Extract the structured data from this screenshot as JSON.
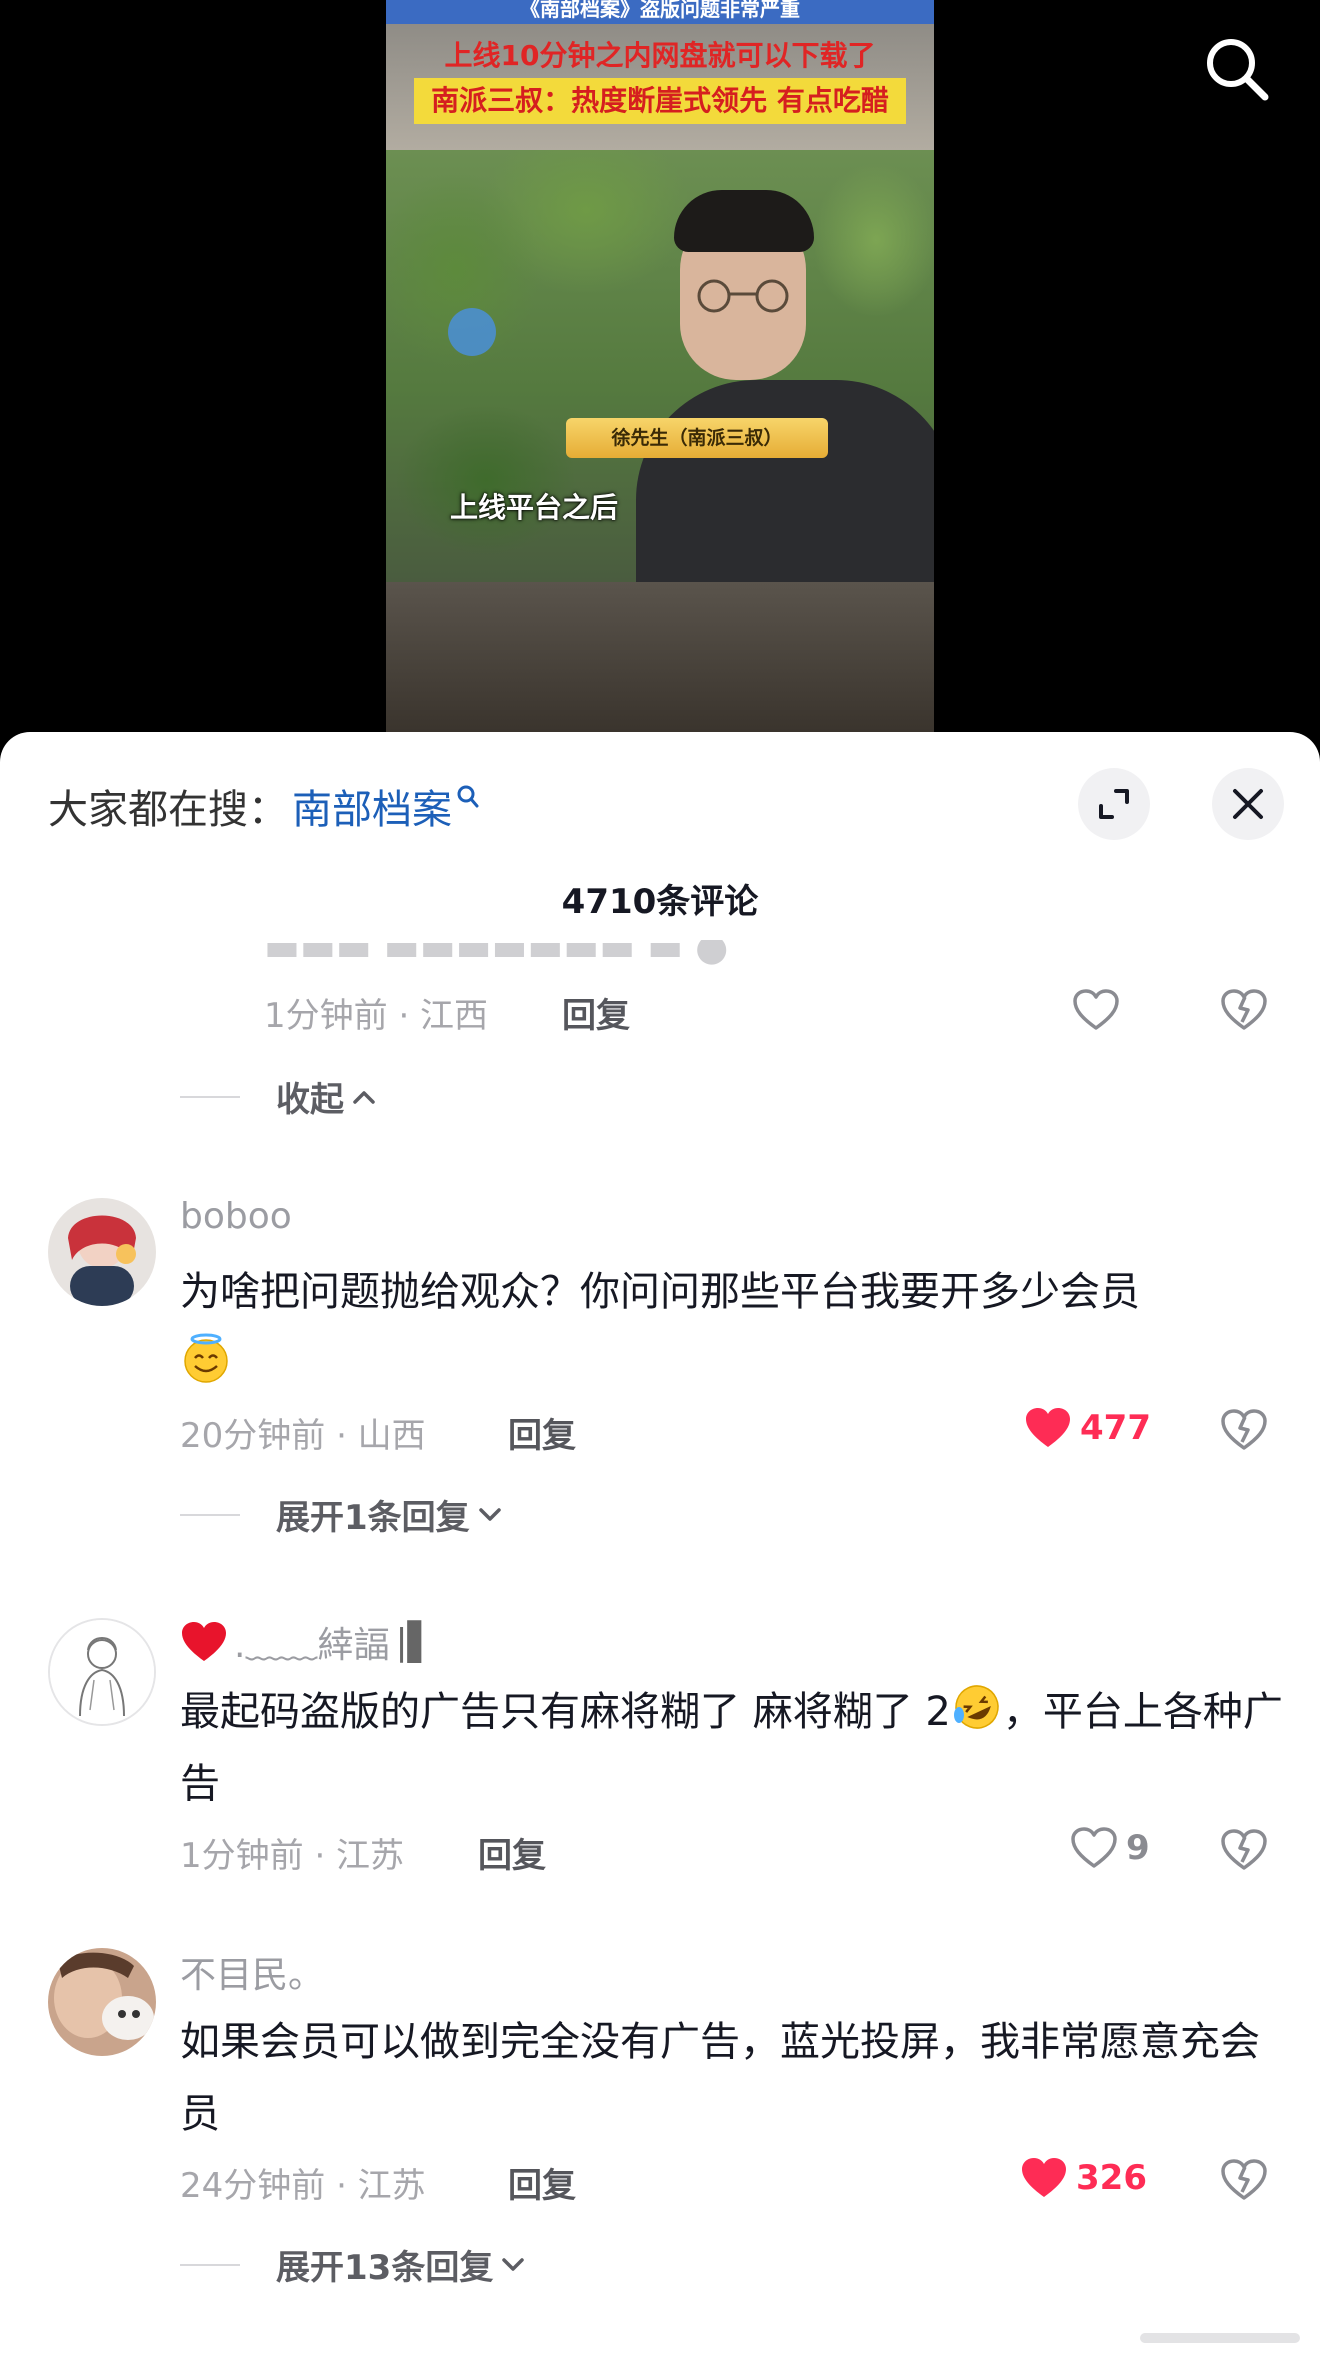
{
  "video": {
    "top_strip": "《南部档案》盗版问题非常严重",
    "headline_1": "上线10分钟之内网盘就可以下载了",
    "headline_2": "南派三叔：热度断崖式领先 有点吃醋",
    "name_tag": "徐先生（南派三叔）",
    "caption": "上线平台之后",
    "search_icon": "search-icon"
  },
  "sheet": {
    "search_prefix": "大家都在搜：",
    "search_term": "南部档案",
    "comment_count": "4710条评论",
    "colors": {
      "accent_link": "#1c5fb8",
      "like_red": "#fe2c55",
      "text_primary": "#161823",
      "text_meta": "#a6a6ab"
    }
  },
  "partial_comment": {
    "time_location": "1分钟前 · 江西",
    "reply_label": "回复",
    "collapse_label": "收起"
  },
  "comments": [
    {
      "username": "boboo",
      "text": "为啥把问题抛给观众？你问问那些平台我要开多少会员",
      "emoji": "smiling-face-with-halo",
      "time_location": "20分钟前 · 山西",
      "reply_label": "回复",
      "likes": "477",
      "liked": true,
      "thread": "展开1条回复"
    },
    {
      "username_prefix": ".﹏﹏緈諨",
      "username_suffix": "|▌",
      "text_before": "最起码盗版的广告只有麻将糊了 麻将糊了 2",
      "emoji": "rolling-on-floor-laughing",
      "text_after": "，平台上各种广告",
      "time_location": "1分钟前 · 江苏",
      "reply_label": "回复",
      "likes": "9",
      "liked": false
    },
    {
      "username": "不目民。",
      "text": "如果会员可以做到完全没有广告，蓝光投屏，我非常愿意充会员",
      "time_location": "24分钟前 · 江苏",
      "reply_label": "回复",
      "likes": "326",
      "liked": true,
      "thread": "展开13条回复"
    }
  ]
}
